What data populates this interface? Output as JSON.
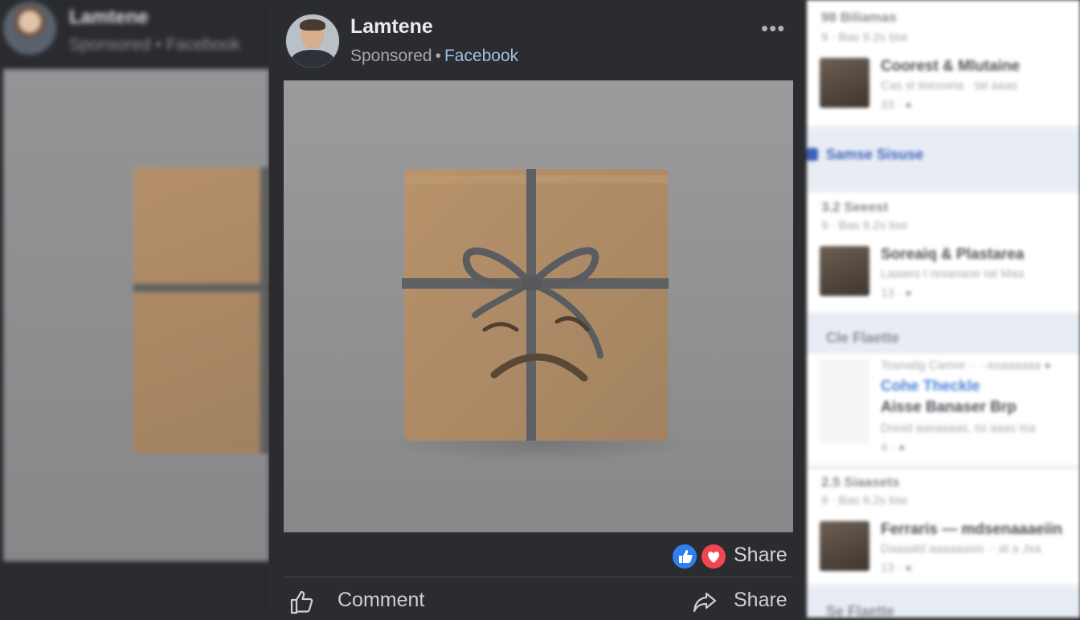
{
  "post": {
    "author": "Lamtene",
    "sponsored": "Sponsored",
    "separator": "•",
    "platform": "Facebook",
    "more_icon": "•••",
    "reactions_share": "Share",
    "actions": {
      "comment": "Comment",
      "share": "Share"
    },
    "reaction_icons": [
      "like-icon",
      "love-icon"
    ],
    "colors": {
      "like": "#2f7ff2",
      "love": "#f0464f",
      "link": "#9fbfe7"
    }
  },
  "left_backdrop": {
    "author": "Lamtene",
    "sub": "Sponsored • Facebook"
  },
  "right_feed": {
    "cards": [
      {
        "header": "98 Biliamas",
        "subheader": "9 · Bas 9.2s tise",
        "title": "Coorest & Mlutaine",
        "line": "Cas st teesseta · tat aaas",
        "meta": "33 · ●"
      },
      {
        "header": "3.2 Seeest",
        "subheader": "9 · Bas 9.2s tise",
        "title": "Soreaiq & Plastarea",
        "line": "Laaaes t resanaoe tat Maa",
        "meta": "13 · ●"
      },
      {
        "header": "",
        "subheader": "",
        "title": "Aisse Banaser Brp",
        "line": "Dooid aasaaaas, tsi aaas tsa",
        "meta": "4 · ●",
        "pretext": "Tosnatig Camre ·· ··esaaaaaa ●",
        "link": "Cohe Theckle"
      },
      {
        "header": "2.5 Siaasets",
        "subheader": "9 · Bas 9.2s tise",
        "title": "Ferraris — mdsenaaaeiin",
        "line": "Daaaald aaaaaasis ·· at a Jsa",
        "meta": "13 · ●"
      }
    ],
    "bands": [
      "Samse Sisuse",
      "Cle Flaette",
      "Se Flaette"
    ]
  }
}
